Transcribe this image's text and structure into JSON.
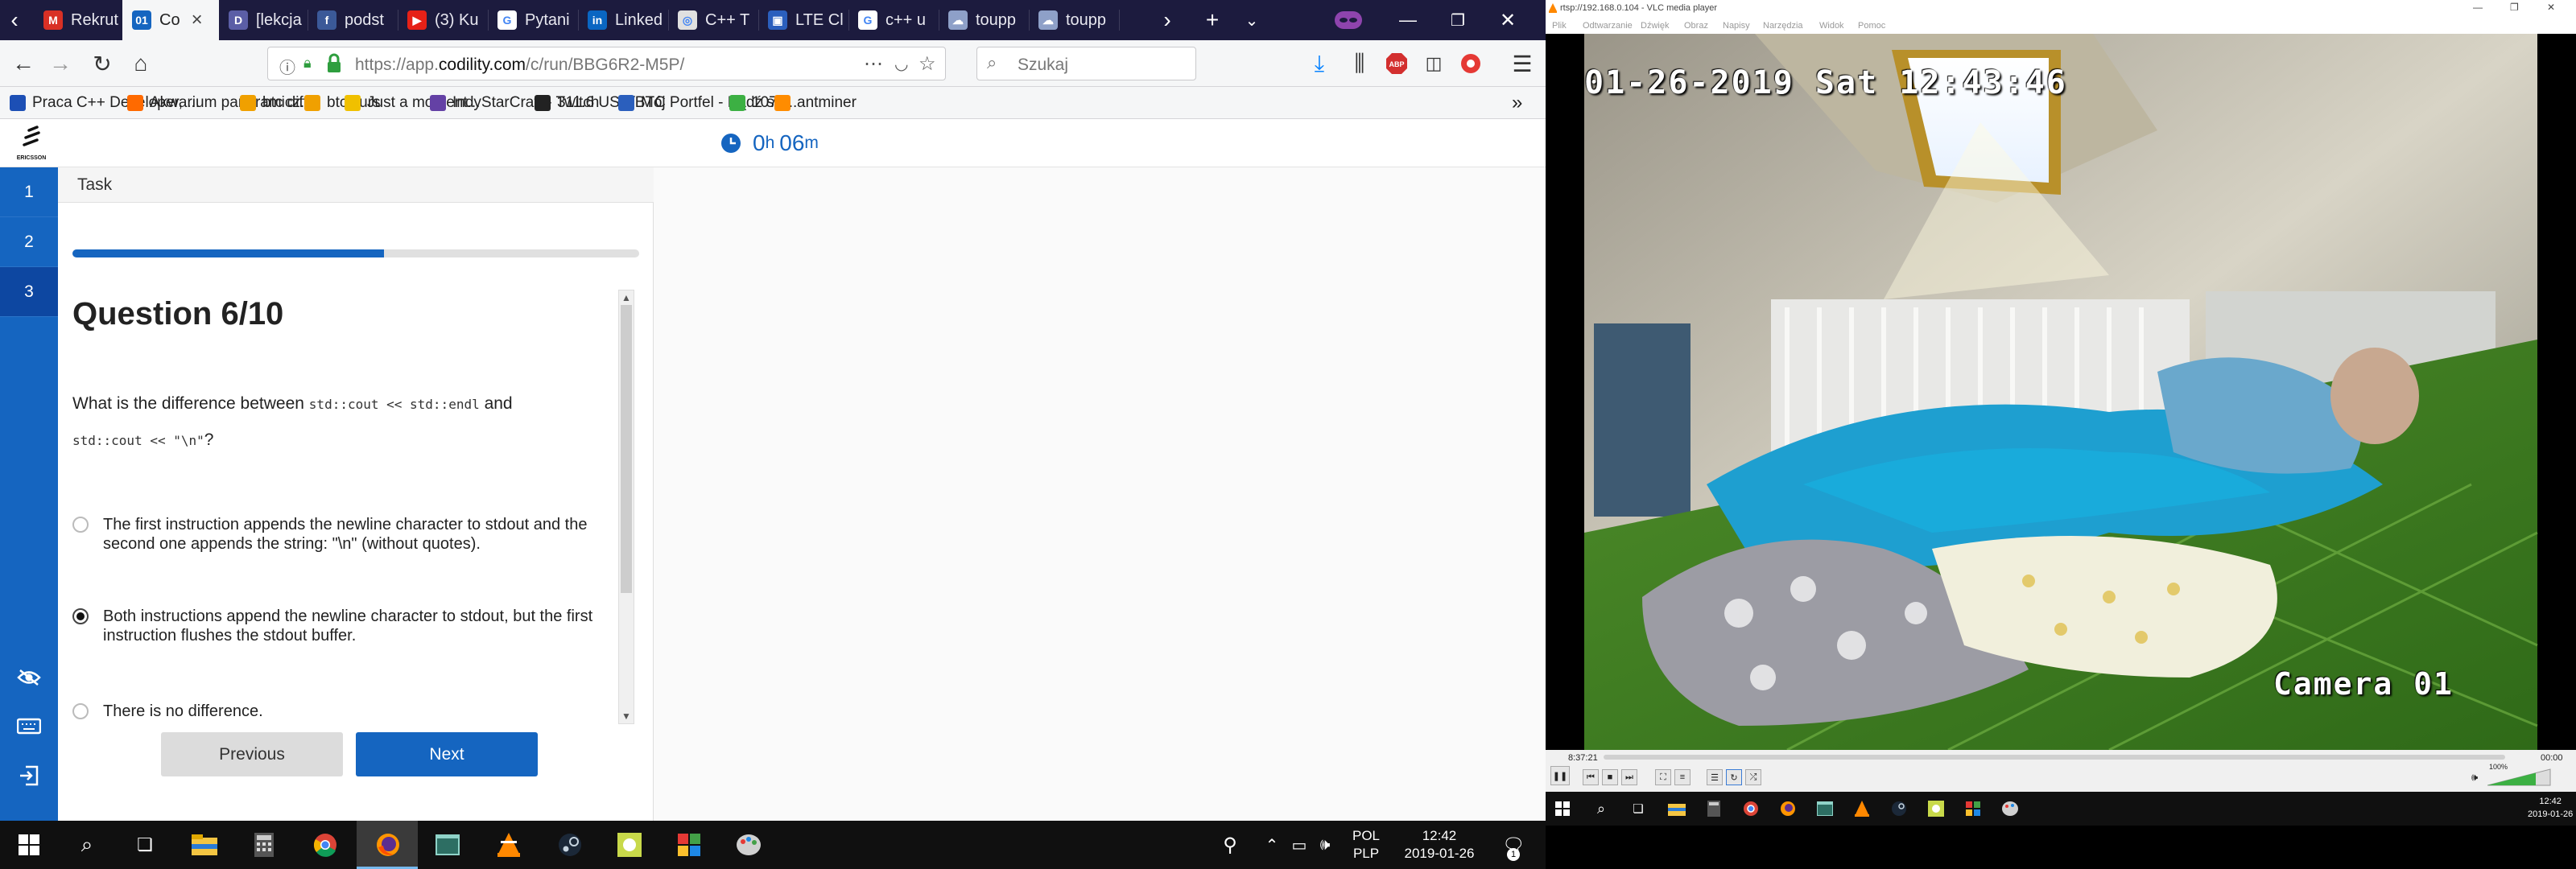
{
  "browser": {
    "tabs": [
      {
        "title": "Rekrut",
        "color": "#d93025",
        "glyph": "M"
      },
      {
        "title": "Co",
        "color": "#1565c0",
        "glyph": "01",
        "active": true
      },
      {
        "title": "[lekcja",
        "color": "#5b5ea6",
        "glyph": "D"
      },
      {
        "title": "podst",
        "color": "#3b5998",
        "glyph": "f"
      },
      {
        "title": "(3) Ku",
        "color": "#e62117",
        "glyph": "▶"
      },
      {
        "title": "Pytani",
        "color": "#ffffff",
        "glyph": "G"
      },
      {
        "title": "Linked",
        "color": "#0a66c2",
        "glyph": "in"
      },
      {
        "title": "C++ T",
        "color": "#e0e0e0",
        "glyph": "◎"
      },
      {
        "title": "LTE Cl",
        "color": "#2b5fbd",
        "glyph": "▣"
      },
      {
        "title": "c++ u",
        "color": "#ffffff",
        "glyph": "G"
      },
      {
        "title": "toupp",
        "color": "#8ea0c8",
        "glyph": "☁"
      },
      {
        "title": "toupp",
        "color": "#8ea0c8",
        "glyph": "☁"
      }
    ],
    "url_prefix": "https://app.",
    "url_domain": "codility.com",
    "url_path": "/c/run/BBG6R2-M5P/",
    "search_placeholder": "Szukaj",
    "bookmarks": [
      {
        "label": "Praca C++ Developer, ...",
        "color": "#1c4fb5"
      },
      {
        "label": "Akwarium panoramicz...",
        "color": "#ff6a00"
      },
      {
        "label": "btc diff",
        "color": "#f0a000"
      },
      {
        "label": "btc kurs",
        "color": "#f0a000"
      },
      {
        "label": "Just a moment...",
        "color": "#f0c000"
      },
      {
        "label": "IndyStarCraft - Twitch",
        "color": "#6441a5"
      },
      {
        "label": "311.6 USD/BTC",
        "color": "#222222"
      },
      {
        "label": "Mój Portfel - Bądź sw...",
        "color": "#2b5fbd"
      },
      {
        "label": "1072",
        "color": "#3cb043"
      },
      {
        "label": "antminer",
        "color": "#ff8c00"
      }
    ]
  },
  "codility": {
    "logo_text": "ERICSSON",
    "timer_hours": "0",
    "timer_h_unit": "h",
    "timer_minutes": "06",
    "timer_m_unit": "m",
    "question_nav": [
      "1",
      "2",
      "3"
    ],
    "current_question_nav": 3,
    "task_tab": "Task",
    "progress_fraction": 0.55,
    "question_title": "Question 6/10",
    "question_prefix": "What is the difference between",
    "question_code1": "std::cout << std::endl",
    "question_and": "and",
    "question_code2": "std::cout << \"\\n\"",
    "question_suffix": "?",
    "options": [
      {
        "text": "The first instruction appends the newline character to stdout and the second one appends the string: \"\\n\" (without quotes).",
        "selected": false
      },
      {
        "text": "Both instructions append the newline character to stdout, but the first instruction flushes the stdout buffer.",
        "selected": true
      },
      {
        "text": "There is no difference.",
        "selected": false
      }
    ],
    "prev_label": "Previous",
    "next_label": "Next"
  },
  "taskbar_left": {
    "lang_top": "POL",
    "lang_bottom": "PLP",
    "time": "12:42",
    "date": "2019-01-26",
    "notif_count": "1"
  },
  "vlc": {
    "title": "rtsp://192.168.0.104 - VLC media player",
    "menu": [
      "Plik",
      "Odtwarzanie",
      "Dźwięk",
      "Obraz",
      "Napisy",
      "Narzędzia",
      "Widok",
      "Pomoc"
    ],
    "osd_datetime": "01-26-2019 Sat 12:43:46",
    "osd_camera": "Camera 01",
    "elapsed": "8:37:21",
    "remaining": "00:00",
    "volume": "100%",
    "tray_time": "12:42",
    "tray_date": "2019-01-26"
  }
}
